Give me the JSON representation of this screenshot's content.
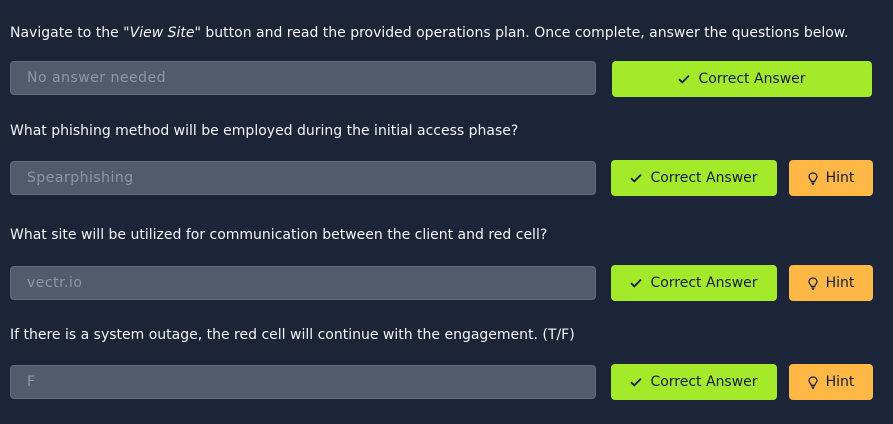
{
  "questions": [
    {
      "prefix": "Navigate to the \"",
      "emphasis": "View Site\"",
      "suffix": "  button and read the provided operations plan. Once complete, answer the questions below.",
      "answer_placeholder": "No answer needed",
      "answer_value": "",
      "correct_label": "Correct Answer",
      "has_hint": false
    },
    {
      "text": "What phishing method will be employed during the initial access phase?",
      "answer_value": "Spearphishing",
      "correct_label": "Correct Answer",
      "hint_label": "Hint",
      "has_hint": true
    },
    {
      "text": "What site will be utilized for communication between the client and red cell?",
      "answer_value": "vectr.io",
      "correct_label": "Correct Answer",
      "hint_label": "Hint",
      "has_hint": true
    },
    {
      "text": "If there is a system outage, the red cell will continue with the engagement. (T/F)",
      "answer_value": "F",
      "correct_label": "Correct Answer",
      "hint_label": "Hint",
      "has_hint": true
    }
  ],
  "icons": {
    "correct": "checkmark-icon",
    "hint": "lightbulb-icon"
  },
  "colors": {
    "background": "#1c2538",
    "field": "#525b6c",
    "correct_button": "#a3ea2a",
    "hint_button": "#ffb746"
  }
}
